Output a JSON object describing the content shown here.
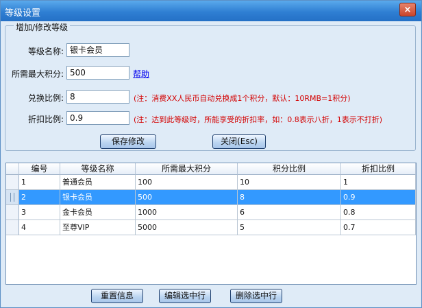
{
  "window": {
    "title": "等级设置",
    "close_label": "×"
  },
  "group": {
    "legend": "增加/修改等级"
  },
  "form": {
    "level_name_label": "等级名称:",
    "level_name_value": "银卡会员",
    "max_points_label": "所需最大积分:",
    "max_points_value": "500",
    "help_link": "帮助",
    "exchange_label": "兑换比例:",
    "exchange_value": "8",
    "exchange_note": "(注：消费XX人民币自动兑换成1个积分，默认：10RMB=1积分)",
    "discount_label": "折扣比例:",
    "discount_value": "0.9",
    "discount_note": "(注：达到此等级时，所能享受的折扣率，如：0.8表示八折，1表示不打折)",
    "save_button": "保存修改",
    "close_button": "关闭(Esc)"
  },
  "table": {
    "headers": [
      "编号",
      "等级名称",
      "所需最大积分",
      "积分比例",
      "折扣比例"
    ],
    "rows": [
      [
        "1",
        "普通会员",
        "100",
        "10",
        "1"
      ],
      [
        "2",
        "银卡会员",
        "500",
        "8",
        "0.9"
      ],
      [
        "3",
        "金卡会员",
        "1000",
        "6",
        "0.8"
      ],
      [
        "4",
        "至尊VIP",
        "5000",
        "5",
        "0.7"
      ]
    ],
    "selected_row": 1
  },
  "footer": {
    "reset_button": "重置信息",
    "edit_button": "编辑选中行",
    "delete_button": "删除选中行"
  }
}
